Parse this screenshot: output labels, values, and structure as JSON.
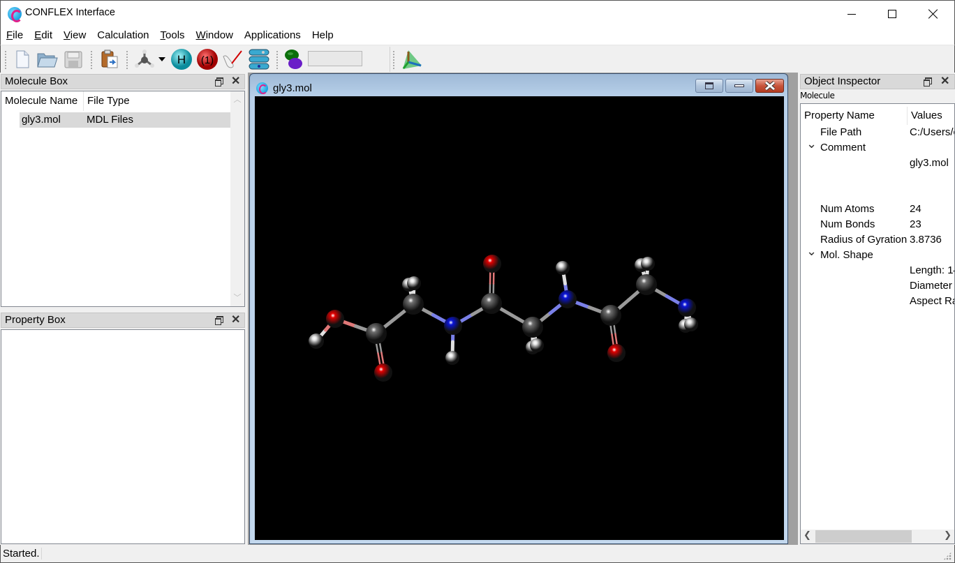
{
  "app": {
    "title": "CONFLEX Interface",
    "icon": "conflex-logo-icon",
    "window_controls": [
      "minimize",
      "maximize",
      "close"
    ]
  },
  "menu": [
    {
      "label": "File",
      "mnemonic": "F"
    },
    {
      "label": "Edit",
      "mnemonic": "E"
    },
    {
      "label": "View",
      "mnemonic": "V"
    },
    {
      "label": "Calculation",
      "mnemonic": ""
    },
    {
      "label": "Tools",
      "mnemonic": "T"
    },
    {
      "label": "Window",
      "mnemonic": "W"
    },
    {
      "label": "Applications",
      "mnemonic": ""
    },
    {
      "label": "Help",
      "mnemonic": ""
    }
  ],
  "toolbar": {
    "buttons": [
      {
        "name": "new-file",
        "icon": "new-document-icon"
      },
      {
        "name": "open-file",
        "icon": "open-folder-icon"
      },
      {
        "name": "save-file",
        "icon": "floppy-disk-icon"
      },
      {
        "name": "paste",
        "icon": "clipboard-icon"
      },
      {
        "name": "build-molecule",
        "icon": "molecule-builder-icon",
        "has_dropdown": true
      },
      {
        "name": "add-hydrogens",
        "icon": "hydrogen-icon",
        "label": "H"
      },
      {
        "name": "charge",
        "icon": "charge-icon",
        "label": "1"
      },
      {
        "name": "measure",
        "icon": "measure-icon"
      },
      {
        "name": "calculation-list",
        "icon": "calculation-stack-icon"
      },
      {
        "name": "orbital",
        "icon": "orbital-icon"
      },
      {
        "name": "axes",
        "icon": "axes-icon"
      }
    ],
    "orbital_field_value": ""
  },
  "molecule_box": {
    "title": "Molecule Box",
    "columns": [
      "Molecule Name",
      "File Type"
    ],
    "rows": [
      {
        "name": "gly3.mol",
        "type": "MDL Files",
        "selected": true
      }
    ]
  },
  "property_box": {
    "title": "Property Box"
  },
  "viewer": {
    "title": "gly3.mol",
    "background": "#000000",
    "atom_colors": {
      "C": "#6e6e6e",
      "N": "#0a14d8",
      "O": "#e00000",
      "H": "#e8e8e8"
    }
  },
  "object_inspector": {
    "title": "Object Inspector",
    "subtitle": "Molecule",
    "columns": [
      "Property Name",
      "Values"
    ],
    "rows": [
      {
        "name": "File Path",
        "value": "C:/Users/c",
        "expandable": false
      },
      {
        "name": "Comment",
        "value": "",
        "expandable": true,
        "expanded": true
      },
      {
        "name": "",
        "value": "gly3.mol",
        "expandable": false
      },
      {
        "name": "",
        "value": "",
        "expandable": false
      },
      {
        "name": "",
        "value": "",
        "expandable": false
      },
      {
        "name": "Num Atoms",
        "value": "24",
        "expandable": false
      },
      {
        "name": "Num Bonds",
        "value": "23",
        "expandable": false
      },
      {
        "name": "Radius of Gyration",
        "value": "3.8736",
        "expandable": false
      },
      {
        "name": "Mol. Shape",
        "value": "",
        "expandable": true,
        "expanded": true
      },
      {
        "name": "",
        "value": "Length: 14",
        "expandable": false
      },
      {
        "name": "",
        "value": "Diameter",
        "expandable": false
      },
      {
        "name": "",
        "value": "Aspect Ra",
        "expandable": false
      }
    ]
  },
  "status": {
    "text": "Started."
  }
}
